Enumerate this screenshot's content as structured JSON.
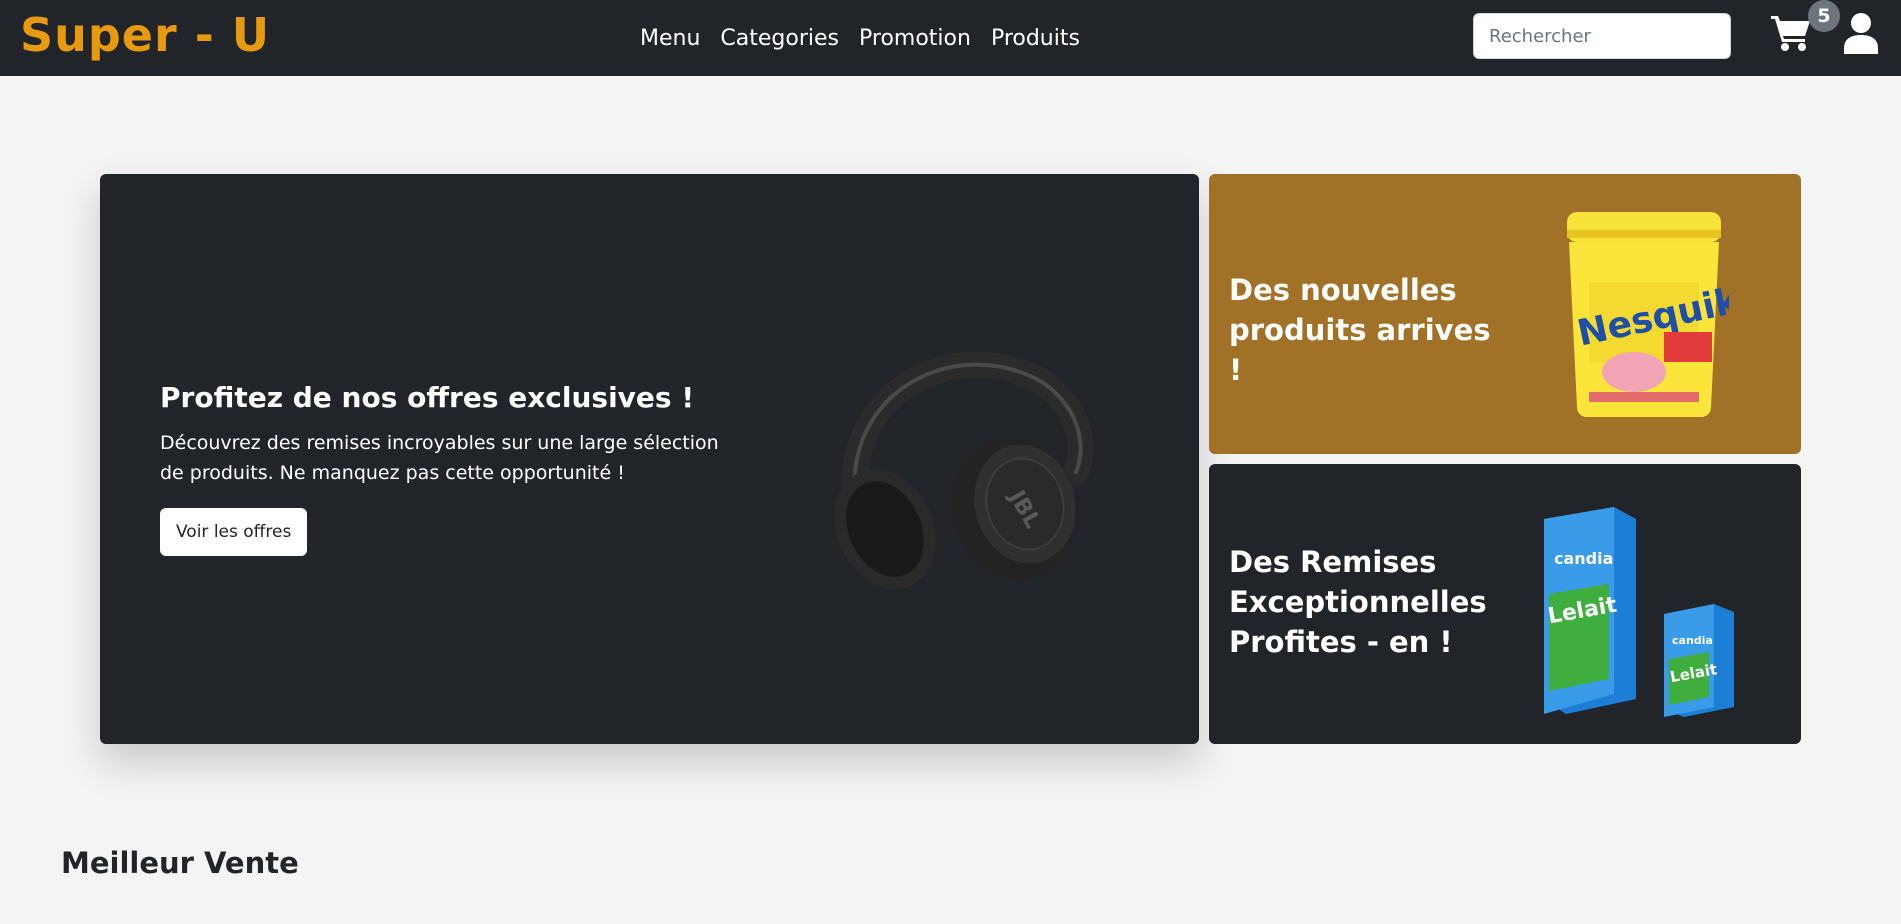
{
  "navbar": {
    "brand": "Super - U",
    "links": [
      "Menu",
      "Categories",
      "Promotion",
      "Produits"
    ],
    "search_placeholder": "Rechercher",
    "cart_count": "5",
    "cart_icon": "cart-icon",
    "user_icon": "user-icon"
  },
  "hero": {
    "title": "Profitez de nos offres exclusives !",
    "description": "Découvrez des remises incroyables sur une large sélection de produits. Ne manquez pas cette opportunité !",
    "button_label": "Voir les offres",
    "image": "headphones-image"
  },
  "side_cards": [
    {
      "title": "Des nouvelles produits arrives !",
      "image": "nesquik-image",
      "color": "#a17127"
    },
    {
      "title": "Des Remises Exceptionnelles Profites - en !",
      "image": "candia-milk-image",
      "color": "#212529"
    }
  ],
  "sections": {
    "best_sellers": "Meilleur Vente"
  },
  "colors": {
    "navbar": "#212529",
    "brand": "#e89a0f",
    "background": "#f4f4f4"
  }
}
